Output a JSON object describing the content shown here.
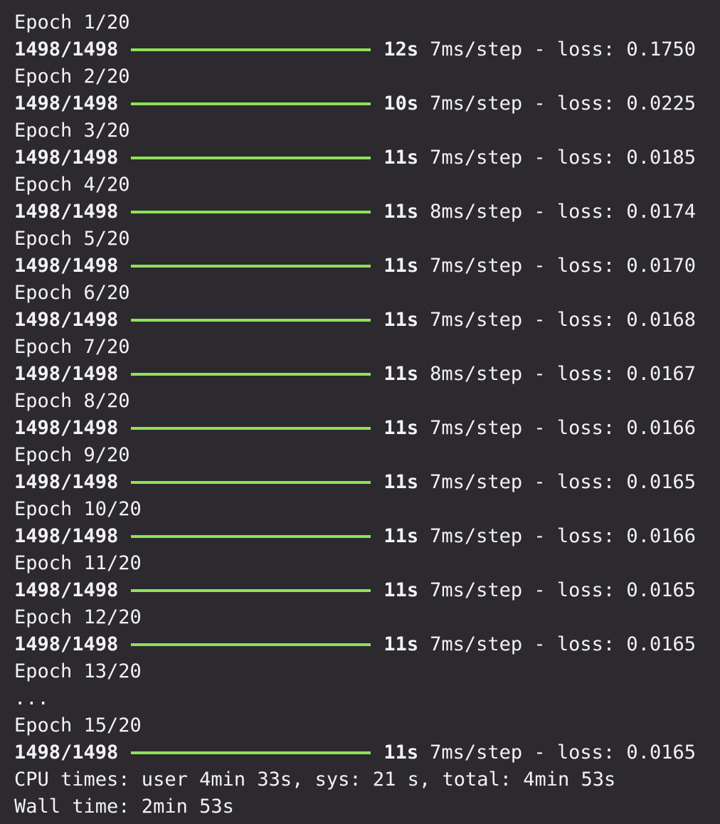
{
  "log": [
    {
      "kind": "epoch",
      "text": "Epoch 1/20"
    },
    {
      "kind": "progress",
      "steps": "1498/1498",
      "progress": 1.0,
      "time": "12s",
      "rest": "7ms/step - loss: 0.1750"
    },
    {
      "kind": "epoch",
      "text": "Epoch 2/20"
    },
    {
      "kind": "progress",
      "steps": "1498/1498",
      "progress": 1.0,
      "time": "10s",
      "rest": "7ms/step - loss: 0.0225"
    },
    {
      "kind": "epoch",
      "text": "Epoch 3/20"
    },
    {
      "kind": "progress",
      "steps": "1498/1498",
      "progress": 1.0,
      "time": "11s",
      "rest": "7ms/step - loss: 0.0185"
    },
    {
      "kind": "epoch",
      "text": "Epoch 4/20"
    },
    {
      "kind": "progress",
      "steps": "1498/1498",
      "progress": 1.0,
      "time": "11s",
      "rest": "8ms/step - loss: 0.0174"
    },
    {
      "kind": "epoch",
      "text": "Epoch 5/20"
    },
    {
      "kind": "progress",
      "steps": "1498/1498",
      "progress": 1.0,
      "time": "11s",
      "rest": "7ms/step - loss: 0.0170"
    },
    {
      "kind": "epoch",
      "text": "Epoch 6/20"
    },
    {
      "kind": "progress",
      "steps": "1498/1498",
      "progress": 1.0,
      "time": "11s",
      "rest": "7ms/step - loss: 0.0168"
    },
    {
      "kind": "epoch",
      "text": "Epoch 7/20"
    },
    {
      "kind": "progress",
      "steps": "1498/1498",
      "progress": 1.0,
      "time": "11s",
      "rest": "8ms/step - loss: 0.0167"
    },
    {
      "kind": "epoch",
      "text": "Epoch 8/20"
    },
    {
      "kind": "progress",
      "steps": "1498/1498",
      "progress": 1.0,
      "time": "11s",
      "rest": "7ms/step - loss: 0.0166"
    },
    {
      "kind": "epoch",
      "text": "Epoch 9/20"
    },
    {
      "kind": "progress",
      "steps": "1498/1498",
      "progress": 1.0,
      "time": "11s",
      "rest": "7ms/step - loss: 0.0165"
    },
    {
      "kind": "epoch",
      "text": "Epoch 10/20"
    },
    {
      "kind": "progress",
      "steps": "1498/1498",
      "progress": 1.0,
      "time": "11s",
      "rest": "7ms/step - loss: 0.0166"
    },
    {
      "kind": "epoch",
      "text": "Epoch 11/20"
    },
    {
      "kind": "progress",
      "steps": "1498/1498",
      "progress": 1.0,
      "time": "11s",
      "rest": "7ms/step - loss: 0.0165"
    },
    {
      "kind": "epoch",
      "text": "Epoch 12/20"
    },
    {
      "kind": "progress",
      "steps": "1498/1498",
      "progress": 1.0,
      "time": "11s",
      "rest": "7ms/step - loss: 0.0165"
    },
    {
      "kind": "epoch",
      "text": "Epoch 13/20"
    },
    {
      "kind": "text",
      "text": "..."
    },
    {
      "kind": "epoch",
      "text": "Epoch 15/20"
    },
    {
      "kind": "progress",
      "steps": "1498/1498",
      "progress": 1.0,
      "time": "11s",
      "rest": "7ms/step - loss: 0.0165"
    },
    {
      "kind": "text",
      "text": "CPU times: user 4min 33s, sys: 21 s, total: 4min 53s"
    },
    {
      "kind": "text",
      "text": "Wall time: 2min 53s"
    }
  ],
  "colors": {
    "background": "#2c2a2e",
    "text": "#f3f2f4",
    "progress_bar": "#8fe15a"
  }
}
